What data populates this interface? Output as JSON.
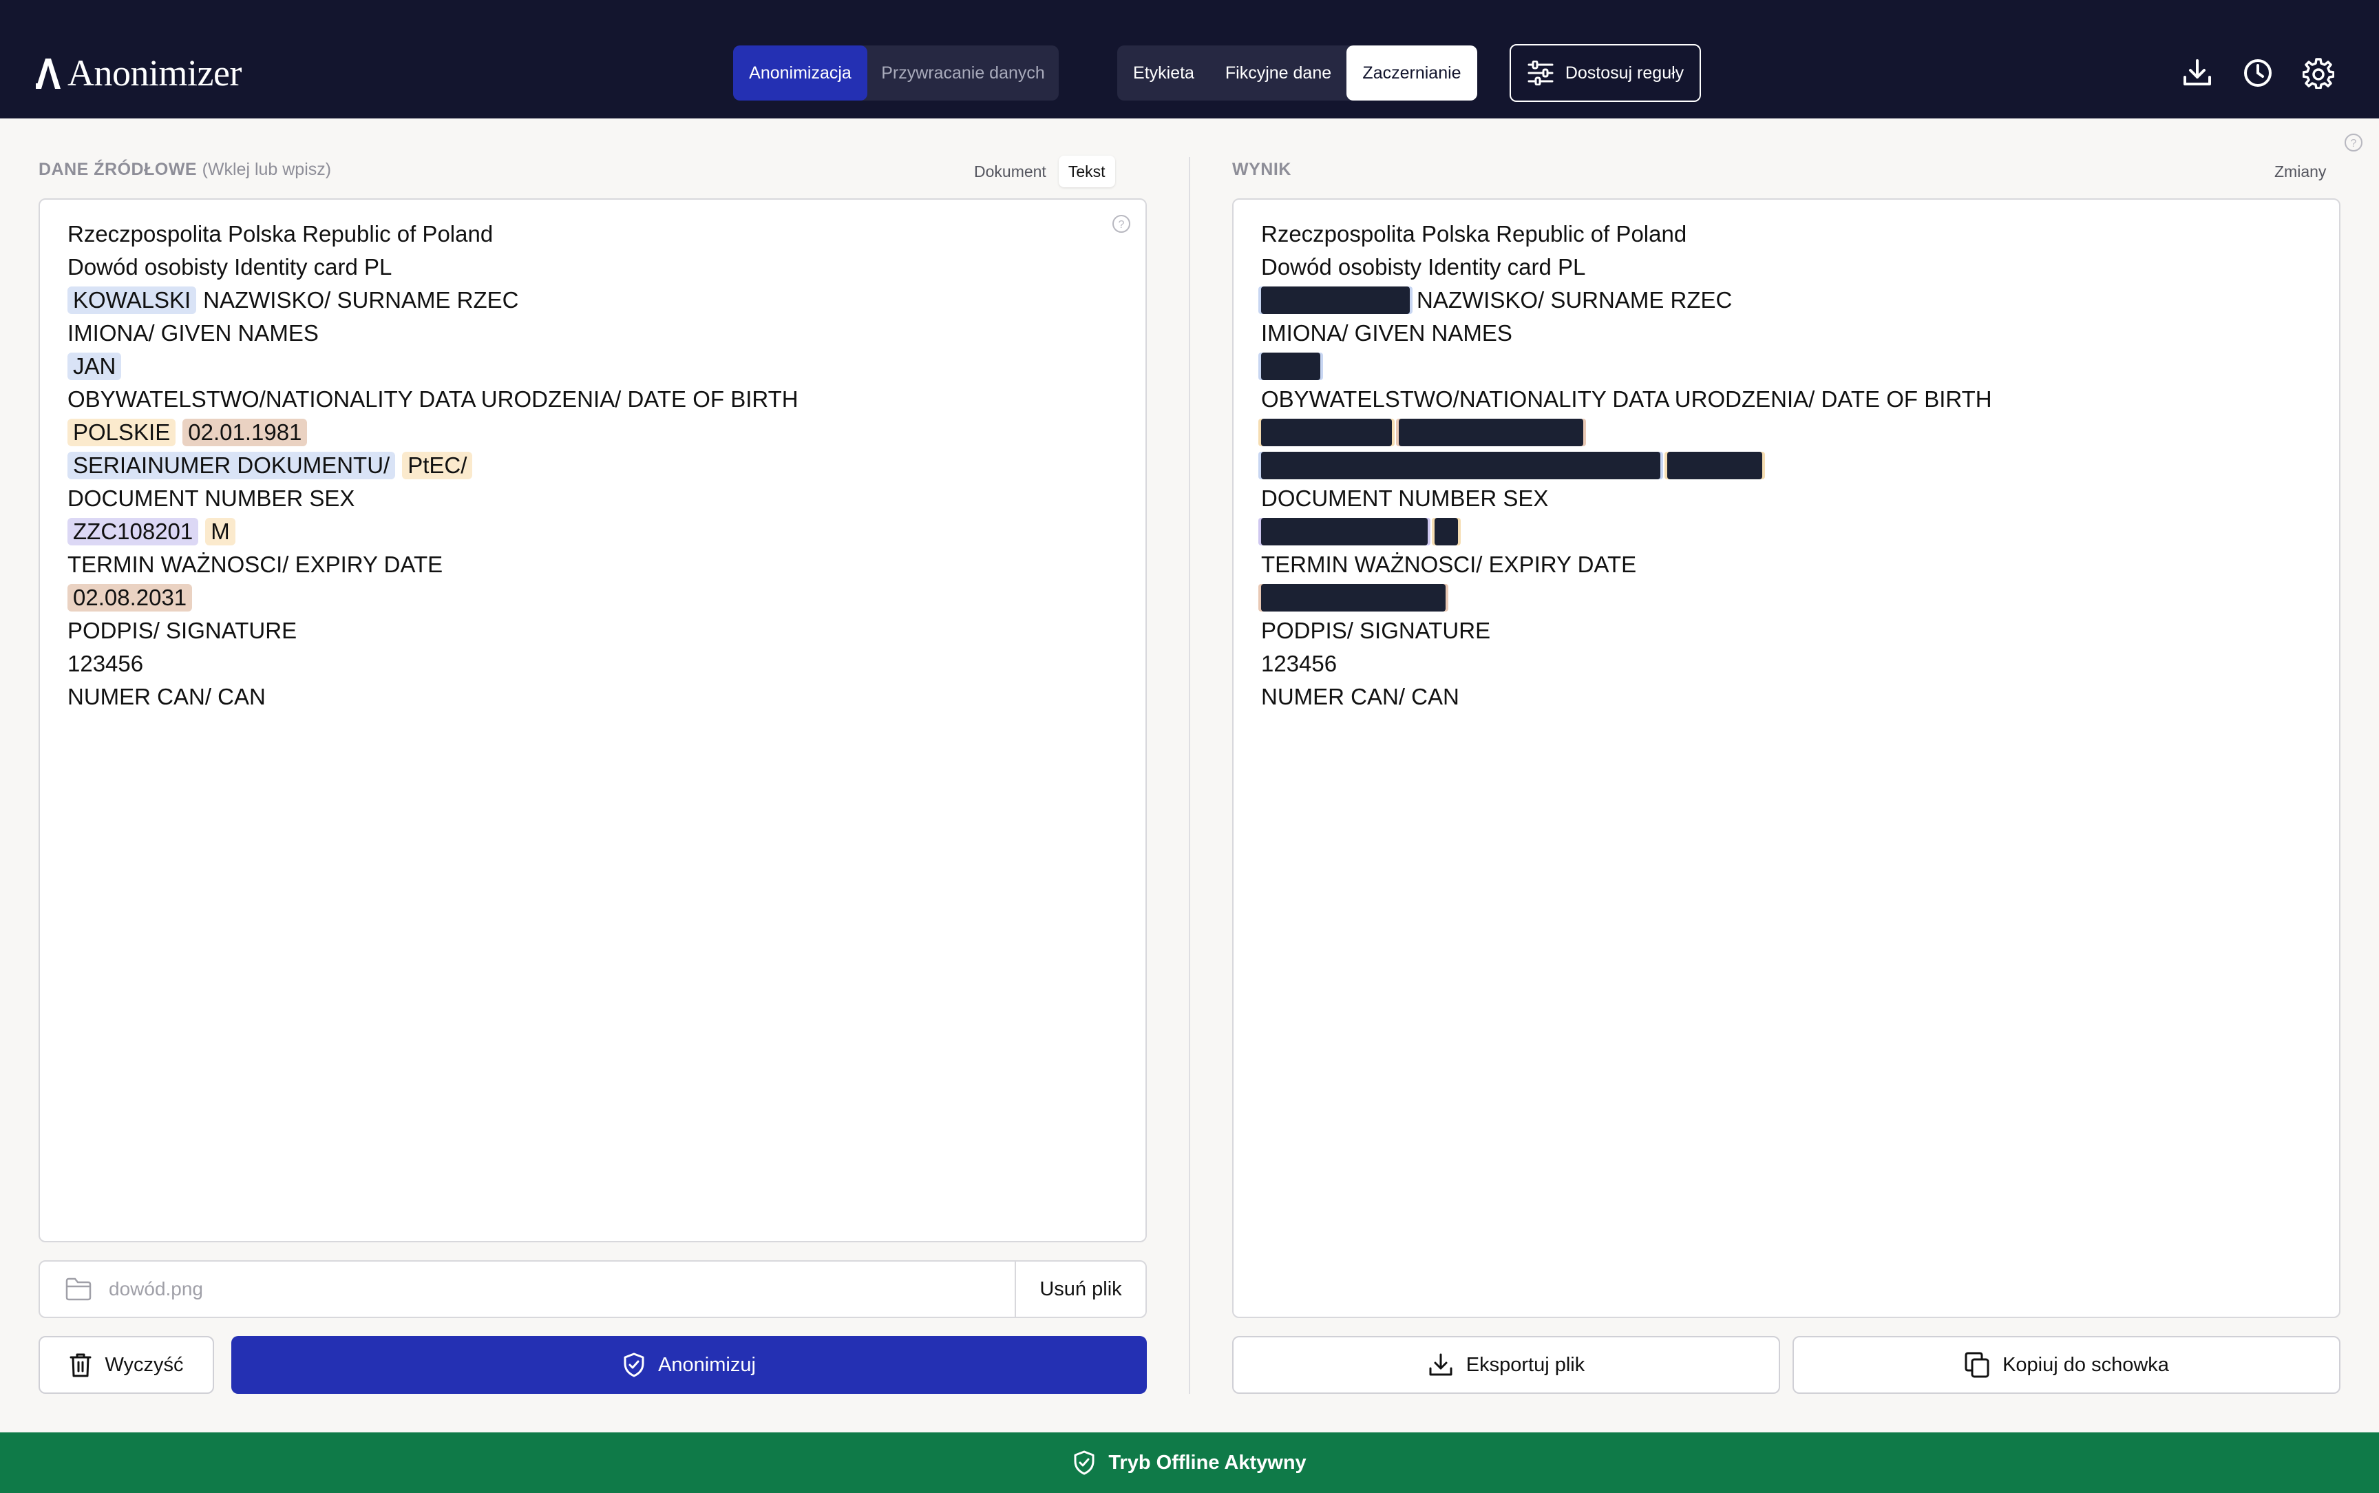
{
  "app": {
    "name": "Anonimizer"
  },
  "header": {
    "mode_tabs": [
      "Anonimizacja",
      "Przywracanie danych"
    ],
    "method_tabs": [
      "Etykieta",
      "Fikcyjne dane",
      "Zaczernianie"
    ],
    "active_mode": "Anonimizacja",
    "active_method": "Zaczernianie",
    "rules_button": "Dostosuj reguły",
    "icons": [
      "download-icon",
      "history-icon",
      "settings-icon"
    ]
  },
  "source": {
    "label": "DANE ŹRÓDŁOWE",
    "hint": "(Wklej lub wpisz)",
    "toggle": [
      "Dokument",
      "Tekst"
    ],
    "active_toggle": "Tekst",
    "lines": [
      [
        {
          "text": "Rzeczpospolita Polska Republic of Poland"
        }
      ],
      [
        {
          "text": "Dowód osobisty Identity card PL"
        }
      ],
      [
        {
          "text": "KOWALSKI",
          "type": "blue"
        },
        {
          "text": "NAZWISKO/ SURNAME RZEC"
        }
      ],
      [
        {
          "text": "IMIONA/ GIVEN NAMES"
        }
      ],
      [
        {
          "text": "JAN",
          "type": "blue"
        }
      ],
      [
        {
          "text": "OBYWATELSTWO/NATIONALITY DATA URODZENIA/ DATE OF BIRTH"
        }
      ],
      [
        {
          "text": "POLSKIE",
          "type": "yellow"
        },
        {
          "text": "02.01.1981",
          "type": "tan"
        }
      ],
      [
        {
          "text": "SERIAINUMER DOKUMENTU/",
          "type": "blue"
        },
        {
          "text": "PtEC/",
          "type": "yellow"
        }
      ],
      [
        {
          "text": "DOCUMENT NUMBER SEX"
        }
      ],
      [
        {
          "text": "ZZC108201",
          "type": "purple"
        },
        {
          "text": "M",
          "type": "yellow"
        }
      ],
      [
        {
          "text": "TERMIN WAŻNOSCI/ EXPIRY DATE"
        }
      ],
      [
        {
          "text": "02.08.2031",
          "type": "tan"
        }
      ],
      [
        {
          "text": "PODPIS/ SIGNATURE"
        }
      ],
      [
        {
          "text": "123456"
        }
      ],
      [
        {
          "text": "NUMER CAN/ CAN"
        }
      ]
    ],
    "file_name": "dowód.png",
    "remove_file_button": "Usuń plik",
    "clear_button": "Wyczyść",
    "anonymize_button": "Anonimizuj"
  },
  "result": {
    "label": "WYNIK",
    "toggle": [
      "Zmiany"
    ],
    "lines": [
      [
        {
          "text": "Rzeczpospolita Polska Republic of Poland"
        }
      ],
      [
        {
          "text": "Dowód osobisty Identity card PL"
        }
      ],
      [
        {
          "redact": "blue",
          "chars": 8
        },
        {
          "text": "NAZWISKO/ SURNAME RZEC"
        }
      ],
      [
        {
          "text": "IMIONA/ GIVEN NAMES"
        }
      ],
      [
        {
          "redact": "blue",
          "chars": 3
        }
      ],
      [
        {
          "text": "OBYWATELSTWO/NATIONALITY DATA URODZENIA/ DATE OF BIRTH"
        }
      ],
      [
        {
          "redact": "yellow",
          "chars": 7
        },
        {
          "redact": "tan",
          "chars": 10
        }
      ],
      [
        {
          "redact": "blue",
          "chars": 22
        },
        {
          "redact": "yellow",
          "chars": 5
        }
      ],
      [
        {
          "text": "DOCUMENT NUMBER SEX"
        }
      ],
      [
        {
          "redact": "purple",
          "chars": 9
        },
        {
          "redact": "yellow",
          "chars": 1
        }
      ],
      [
        {
          "text": "TERMIN WAŻNOSCI/ EXPIRY DATE"
        }
      ],
      [
        {
          "redact": "tan",
          "chars": 10
        }
      ],
      [
        {
          "text": "PODPIS/ SIGNATURE"
        }
      ],
      [
        {
          "text": "123456"
        }
      ],
      [
        {
          "text": "NUMER CAN/ CAN"
        }
      ]
    ],
    "export_button": "Eksportuj plik",
    "copy_button": "Kopiuj do schowka"
  },
  "footer": {
    "status": "Tryb Offline Aktywny"
  },
  "colors": {
    "header_bg": "#13152e",
    "accent": "#2430b3",
    "footer_bg": "#0f7a48",
    "redaction": "#1b2133"
  }
}
